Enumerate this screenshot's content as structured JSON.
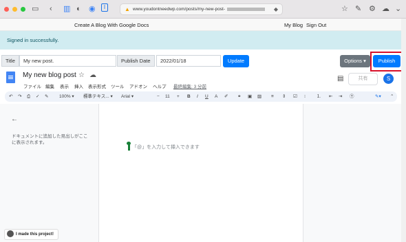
{
  "browser": {
    "url": "www.youdontneedwp.com/posts/my-new-post-"
  },
  "site": {
    "brand": "Create A Blog With Google Docs",
    "nav": {
      "my_blog": "My Blog",
      "sign_out": "Sign Out"
    },
    "flash": "Signed in successfully."
  },
  "form": {
    "title_label": "Title",
    "title_value": "My new post.",
    "date_label": "Publish Date",
    "date_value": "2022/01/18",
    "update_label": "Update",
    "options_label": "Options",
    "publish_label": "Publish"
  },
  "docs": {
    "title": "My new blog post",
    "menu": [
      "ファイル",
      "編集",
      "表示",
      "挿入",
      "表示形式",
      "ツール",
      "アドオン",
      "ヘルプ"
    ],
    "last_edit": "最終編集: 3 分前",
    "share_label": "共有",
    "avatar_letter": "S",
    "toolbar": {
      "zoom": "100%",
      "style": "標準テキス...",
      "font": "Arial",
      "size": "11"
    },
    "outline_text_1": "ドキュメントに追加した見出しがここ",
    "outline_text_2": "に表示されます。",
    "placeholder": "「@」を入力して挿入できます"
  },
  "footer": {
    "badge": "I made this project!"
  },
  "colors": {
    "primary": "#007bff",
    "highlight": "#d8102a",
    "flash_bg": "#d1ecf1"
  }
}
